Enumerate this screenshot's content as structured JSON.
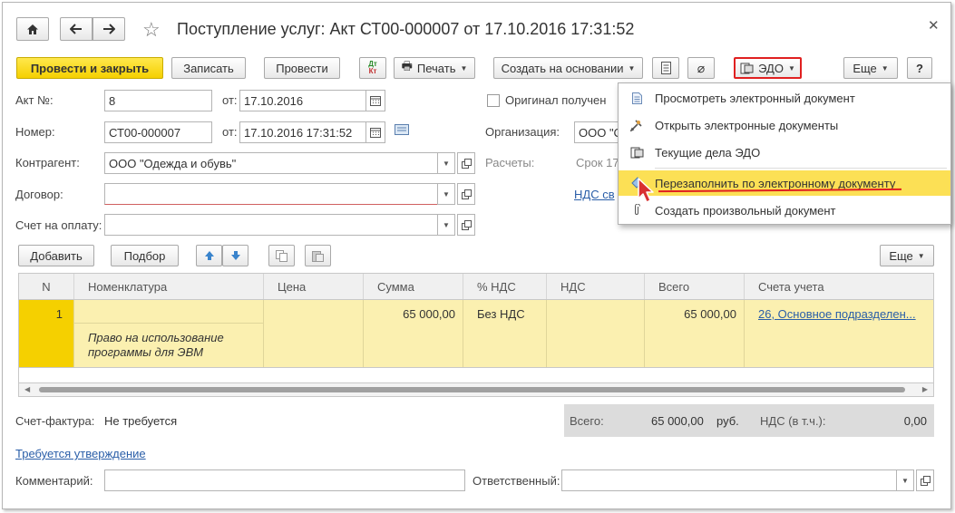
{
  "window": {
    "title": "Поступление услуг: Акт СТ00-000007 от 17.10.2016 17:31:52"
  },
  "toolbar": {
    "post_close": "Провести и закрыть",
    "save": "Записать",
    "post": "Провести",
    "print": "Печать",
    "create_based": "Создать на основании",
    "edo": "ЭДО",
    "more": "Еще",
    "help": "?"
  },
  "form": {
    "act_no_label": "Акт №:",
    "act_no": "8",
    "from_label": "от:",
    "act_date": "17.10.2016",
    "original_label": "Оригинал получен",
    "number_label": "Номер:",
    "number": "СТ00-000007",
    "from2_label": "от:",
    "doc_datetime": "17.10.2016 17:31:52",
    "org_label": "Организация:",
    "org_value": "ООО \"С",
    "contractor_label": "Контрагент:",
    "contractor": "ООО \"Одежда и обувь\"",
    "settlements_label": "Расчеты:",
    "settlements_value": "Срок 17",
    "contract_label": "Договор:",
    "contract": "",
    "vat_link": "НДС св",
    "invoice_label": "Счет на оплату:",
    "invoice": ""
  },
  "table_toolbar": {
    "add": "Добавить",
    "pick": "Подбор",
    "more": "Еще"
  },
  "table": {
    "headers": [
      "N",
      "Номенклатура",
      "Цена",
      "Сумма",
      "% НДС",
      "НДС",
      "Всего",
      "Счета учета"
    ],
    "rows": [
      {
        "n": "1",
        "item": "Право на использование программы для ЭВМ",
        "price": "",
        "sum": "65 000,00",
        "vat_rate": "Без НДС",
        "vat": "",
        "total": "65 000,00",
        "account": "26, Основное подразделен..."
      }
    ]
  },
  "footer": {
    "invoice_label": "Счет-фактура:",
    "invoice_value": "Не требуется",
    "total_label": "Всего:",
    "total_value": "65 000,00",
    "currency": "руб.",
    "vat_label": "НДС (в т.ч.):",
    "vat_value": "0,00",
    "approval_link": "Требуется утверждение",
    "comment_label": "Комментарий:",
    "comment": "",
    "responsible_label": "Ответственный:",
    "responsible": ""
  },
  "edo_menu": {
    "items": [
      {
        "label": "Просмотреть электронный документ",
        "icon": "document-icon"
      },
      {
        "label": "Открыть электронные документы",
        "icon": "tools-icon"
      },
      {
        "label": "Текущие дела ЭДО",
        "icon": "edo-icon"
      },
      {
        "label": "Перезаполнить по электронному документу",
        "icon": "refill-icon"
      },
      {
        "label": "Создать произвольный документ",
        "icon": "paperclip-icon"
      }
    ]
  },
  "colors": {
    "accent_yellow": "#f5d000",
    "highlight": "#fce055",
    "link": "#2a5ea8",
    "edo_border": "#e02020"
  }
}
